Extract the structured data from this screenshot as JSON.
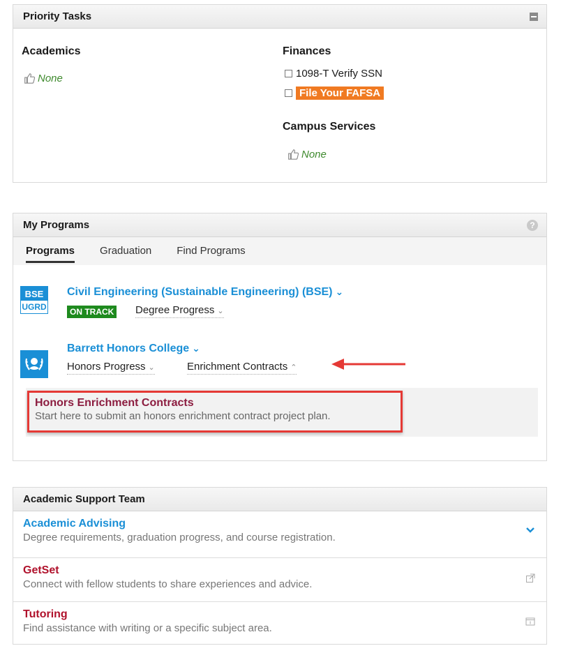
{
  "priority_tasks": {
    "title": "Priority Tasks",
    "academics": {
      "heading": "Academics",
      "none_label": "None"
    },
    "finances": {
      "heading": "Finances",
      "tasks": [
        "1098-T Verify SSN",
        "File Your FAFSA"
      ]
    },
    "campus_services": {
      "heading": "Campus Services",
      "none_label": "None"
    }
  },
  "my_programs": {
    "title": "My Programs",
    "help_label": "?",
    "tabs": [
      {
        "label": "Programs",
        "active": true
      },
      {
        "label": "Graduation",
        "active": false
      },
      {
        "label": "Find Programs",
        "active": false
      }
    ],
    "program1": {
      "badge_top": "BSE",
      "badge_bottom": "UGRD",
      "title": "Civil Engineering (Sustainable Engineering) (BSE)",
      "status": "ON TRACK",
      "link": "Degree Progress"
    },
    "program2": {
      "title": "Barrett Honors College",
      "link1": "Honors Progress",
      "link2": "Enrichment Contracts"
    },
    "contract": {
      "title": "Honors Enrichment Contracts",
      "description": "Start here to submit an honors enrichment contract project plan."
    }
  },
  "support_team": {
    "title": "Academic Support Team",
    "items": [
      {
        "title": "Academic Advising",
        "description": "Degree requirements, graduation progress, and course registration.",
        "color": "#1a8fd6",
        "icon": "chevron-down-icon"
      },
      {
        "title": "GetSet",
        "description": "Connect with fellow students to share experiences and advice.",
        "color": "#b0122c",
        "icon": "external-link-icon"
      },
      {
        "title": "Tutoring",
        "description": "Find assistance with writing or a specific subject area.",
        "color": "#b0122c",
        "icon": "popup-icon"
      }
    ]
  },
  "colors": {
    "accent_blue": "#1a8fd6",
    "maroon": "#8c1d40",
    "on_track_green": "#1e8a1e",
    "fafsa_orange": "#f07a22",
    "highlight_red": "#e53935"
  }
}
